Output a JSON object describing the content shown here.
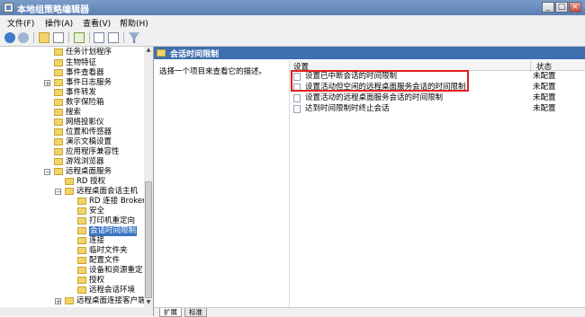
{
  "window": {
    "title": "本地组策略编辑器",
    "controls": [
      "_",
      "□",
      "×"
    ]
  },
  "menu": [
    "文件(F)",
    "操作(A)",
    "查看(V)",
    "帮助(H)"
  ],
  "toolbar": [
    "back-icon",
    "forward-icon",
    "up-folder-icon",
    "show-pane-icon",
    "export-icon",
    "properties-icon",
    "help-icon",
    "filter-icon"
  ],
  "tree": [
    {
      "label": "任务计划程序"
    },
    {
      "label": "生物特征"
    },
    {
      "label": "事件查看器"
    },
    {
      "label": "事件日志服务"
    },
    {
      "label": "事件转发"
    },
    {
      "label": "数字保险箱"
    },
    {
      "label": "搜索"
    },
    {
      "label": "网络投影仪"
    },
    {
      "label": "位置和传感器"
    },
    {
      "label": "演示文稿设置"
    },
    {
      "label": "应用程序兼容性"
    },
    {
      "label": "游戏浏览器"
    },
    {
      "label": "远程桌面服务"
    },
    {
      "label": "RD 授权"
    },
    {
      "label": "远程桌面会话主机"
    },
    {
      "label": "RD 连接 Broker"
    },
    {
      "label": "安全"
    },
    {
      "label": "打印机重定向"
    },
    {
      "label": "会话时间限制"
    },
    {
      "label": "连接"
    },
    {
      "label": "临时文件夹"
    },
    {
      "label": "配置文件"
    },
    {
      "label": "设备和资源重定"
    },
    {
      "label": "授权"
    },
    {
      "label": "远程会话环境"
    },
    {
      "label": "远程桌面连接客户端"
    }
  ],
  "right": {
    "header_title": "会话时间限制",
    "description": "选择一个项目来查看它的描述。",
    "col_setting": "设置",
    "col_state": "状态",
    "rows": [
      {
        "name": "设置已中断会话的时间限制",
        "state": "未配置"
      },
      {
        "name": "设置活动但空闲的远程桌面服务会话的时间限制",
        "state": "未配置"
      },
      {
        "name": "设置活动的远程桌面服务会话的时间限制",
        "state": "未配置"
      },
      {
        "name": "达到时间限制时终止会话",
        "state": "未配置"
      }
    ],
    "tabs": [
      "扩展",
      "标准"
    ]
  }
}
